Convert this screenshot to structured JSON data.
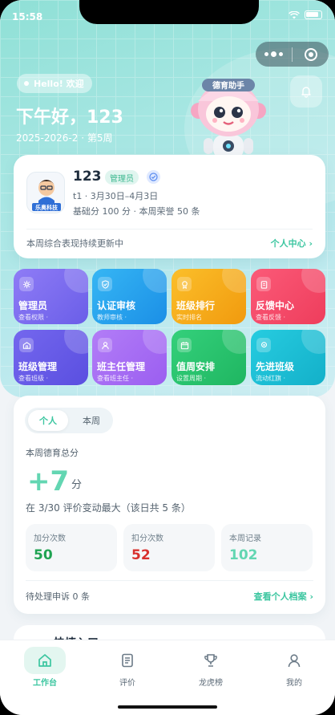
{
  "status_bar": {
    "time": "15:58"
  },
  "header": {
    "hello": "Hello! 欢迎",
    "greeting": "下午好，123",
    "term": "2025-2026-2 · 第5周",
    "mascot_label": "德育助手"
  },
  "profile": {
    "name": "123",
    "role": "管理员",
    "logo_text": "乐奥科技",
    "line1": "t1 · 3月30日–4月3日",
    "line2": "基础分 100 分 · 本周荣誉 50 条",
    "footer": "本周综合表现持续更新中",
    "link": "个人中心 ›"
  },
  "tiles": [
    {
      "title": "管理员",
      "sub": "查看权限 ·",
      "color_from": "#8f7cf6",
      "color_to": "#6a5ee8",
      "icon": "gear-icon"
    },
    {
      "title": "认证审核",
      "sub": "教师审核 ·",
      "color_from": "#36b6f4",
      "color_to": "#1b8fe6",
      "icon": "shield-check-icon"
    },
    {
      "title": "班级排行",
      "sub": "实时排名",
      "color_from": "#fbbf2a",
      "color_to": "#f19a0e",
      "icon": "medal-icon"
    },
    {
      "title": "反馈中心",
      "sub": "查看反馈 ·",
      "color_from": "#fb5a78",
      "color_to": "#ee3d5c",
      "icon": "clipboard-icon"
    },
    {
      "title": "班级管理",
      "sub": "查看班级 ·",
      "color_from": "#7467ee",
      "color_to": "#5a4fe0",
      "icon": "school-icon"
    },
    {
      "title": "班主任管理",
      "sub": "查看班主任 ·",
      "color_from": "#b27df7",
      "color_to": "#9b5ef0",
      "icon": "user-icon"
    },
    {
      "title": "值周安排",
      "sub": "设置周期 ·",
      "color_from": "#34d07b",
      "color_to": "#1fb661",
      "icon": "calendar-icon"
    },
    {
      "title": "先进班级",
      "sub": "流动红旗 ·",
      "color_from": "#27cce0",
      "color_to": "#13b0c9",
      "icon": "award-icon"
    }
  ],
  "score": {
    "tab_active": "个人",
    "tab_inactive": "本周",
    "label": "本周德育总分",
    "value": "+7",
    "unit": "分",
    "note": "在 3/30 评价变动最大（该日共 5 条）",
    "stats": [
      {
        "label": "加分次数",
        "value": "50",
        "color": "#1fa352"
      },
      {
        "label": "扣分次数",
        "value": "52",
        "color": "#d8302d"
      },
      {
        "label": "本周记录",
        "value": "102",
        "color": "#63d6b2"
      }
    ],
    "pending": "待处理申诉 0 条",
    "link": "查看个人档案 ›"
  },
  "quick": {
    "title": "快捷入口"
  },
  "tabbar": {
    "items": [
      {
        "label": "工作台",
        "icon": "home-icon",
        "active": true
      },
      {
        "label": "评价",
        "icon": "document-icon",
        "active": false
      },
      {
        "label": "龙虎榜",
        "icon": "trophy-icon",
        "active": false
      },
      {
        "label": "我的",
        "icon": "person-icon",
        "active": false
      }
    ]
  }
}
